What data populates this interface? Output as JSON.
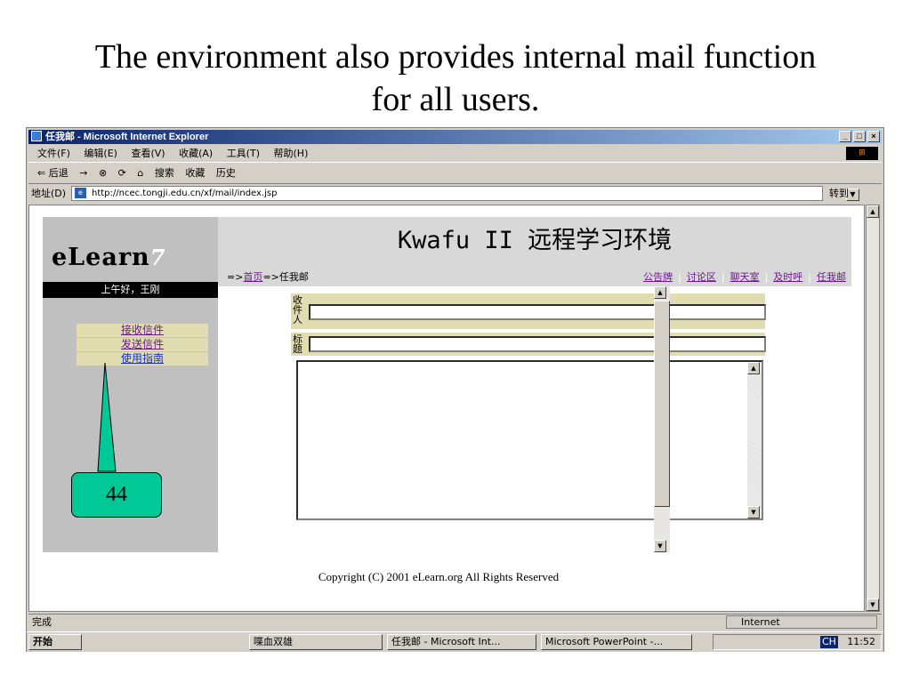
{
  "slide": {
    "title_line1": "The environment also provides internal mail function",
    "title_line2": "for all users."
  },
  "window": {
    "title": "任我邮 - Microsoft Internet Explorer",
    "minimize": "_",
    "maximize": "□",
    "close": "×"
  },
  "menu": [
    "文件(F)",
    "编辑(E)",
    "查看(V)",
    "收藏(A)",
    "工具(T)",
    "帮助(H)"
  ],
  "toolbar": {
    "back": "⇐ 后退",
    "forward": "→",
    "stop": "⊗",
    "refresh": "⟳",
    "home": "⌂",
    "search": "搜索",
    "favorites": "收藏",
    "history": "历史"
  },
  "address": {
    "label": "地址(D)",
    "url": "http://ncec.tongji.edu.cn/xf/mail/index.jsp",
    "go": "转到"
  },
  "page": {
    "logo": "eLearn",
    "greeting": "上午好，王刚",
    "left_nav": [
      "接收信件",
      "发送信件",
      "使用指南"
    ],
    "site_title": "Kwafu II 远程学习环境",
    "breadcrumb_prefix": "=>",
    "breadcrumb_home": "首页",
    "breadcrumb_rest": "=>任我邮",
    "top_links": [
      "公告牌",
      "讨论区",
      "聊天室",
      "及时呼",
      "任我邮"
    ],
    "recipient_label": "收件人",
    "subject_label": "标题",
    "recipient_value": "",
    "subject_value": "",
    "copyright": "Copyright (C) 2001 eLearn.org All Rights Reserved"
  },
  "callout": {
    "text": "44",
    "color": "#00c896"
  },
  "status": {
    "text": "完成",
    "zone": "Internet"
  },
  "taskbar": {
    "start": "开始",
    "items": [
      "喋血双雄",
      "任我邮 - Microsoft Int...",
      "Microsoft PowerPoint -..."
    ],
    "lang": "CH",
    "clock": "11:52"
  }
}
